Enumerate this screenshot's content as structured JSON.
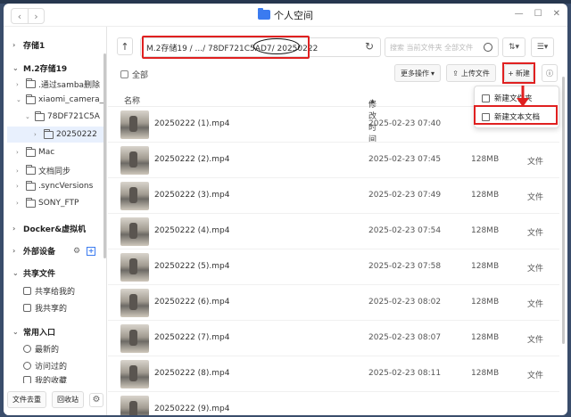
{
  "window": {
    "title": "个人空间"
  },
  "sidebar": {
    "section_storage1": "存储1",
    "section_m2": "M.2存储19",
    "tree": [
      {
        "label": ".通过samba删除"
      },
      {
        "label": "xiaomi_camera_"
      },
      {
        "label": "78DF721C5A"
      },
      {
        "label": "20250222"
      },
      {
        "label": "Mac"
      },
      {
        "label": "文档同步"
      },
      {
        "label": ".syncVersions"
      },
      {
        "label": "SONY_FTP"
      }
    ],
    "section_docker": "Docker&虚拟机",
    "section_external": "外部设备",
    "section_shared": "共享文件",
    "shared_links": [
      {
        "label": "共享给我的"
      },
      {
        "label": "我共享的"
      }
    ],
    "section_common": "常用入口",
    "common_links": [
      {
        "label": "最新的"
      },
      {
        "label": "访问过的"
      },
      {
        "label": "我的收藏"
      }
    ],
    "footer": {
      "dedupe": "文件去重",
      "recycle": "回收站"
    }
  },
  "toolbar": {
    "path": "M.2存储19 / .../ 78DF721C5AD7/ 20250222",
    "search_placeholder": "搜索 当前文件夹 全部文件",
    "select_all": "全部",
    "more_ops": "更多操作",
    "upload": "上传文件",
    "new": "新建"
  },
  "new_menu": {
    "new_folder": "新建文件夹",
    "new_text_doc": "新建文本文档"
  },
  "table": {
    "col_name": "名称",
    "col_modified": "修改时间",
    "sort_indicator": "▲",
    "rows": [
      {
        "name": "20250222 (1).mp4",
        "time": "2025-02-23 07:40",
        "size": "",
        "type": ""
      },
      {
        "name": "20250222 (2).mp4",
        "time": "2025-02-23 07:45",
        "size": "128MB",
        "type": "文件"
      },
      {
        "name": "20250222 (3).mp4",
        "time": "2025-02-23 07:49",
        "size": "128MB",
        "type": "文件"
      },
      {
        "name": "20250222 (4).mp4",
        "time": "2025-02-23 07:54",
        "size": "128MB",
        "type": "文件"
      },
      {
        "name": "20250222 (5).mp4",
        "time": "2025-02-23 07:58",
        "size": "128MB",
        "type": "文件"
      },
      {
        "name": "20250222 (6).mp4",
        "time": "2025-02-23 08:02",
        "size": "128MB",
        "type": "文件"
      },
      {
        "name": "20250222 (7).mp4",
        "time": "2025-02-23 08:07",
        "size": "128MB",
        "type": "文件"
      },
      {
        "name": "20250222 (8).mp4",
        "time": "2025-02-23 08:11",
        "size": "128MB",
        "type": "文件"
      },
      {
        "name": "20250222 (9).mp4",
        "time": "",
        "size": "",
        "type": ""
      }
    ]
  }
}
